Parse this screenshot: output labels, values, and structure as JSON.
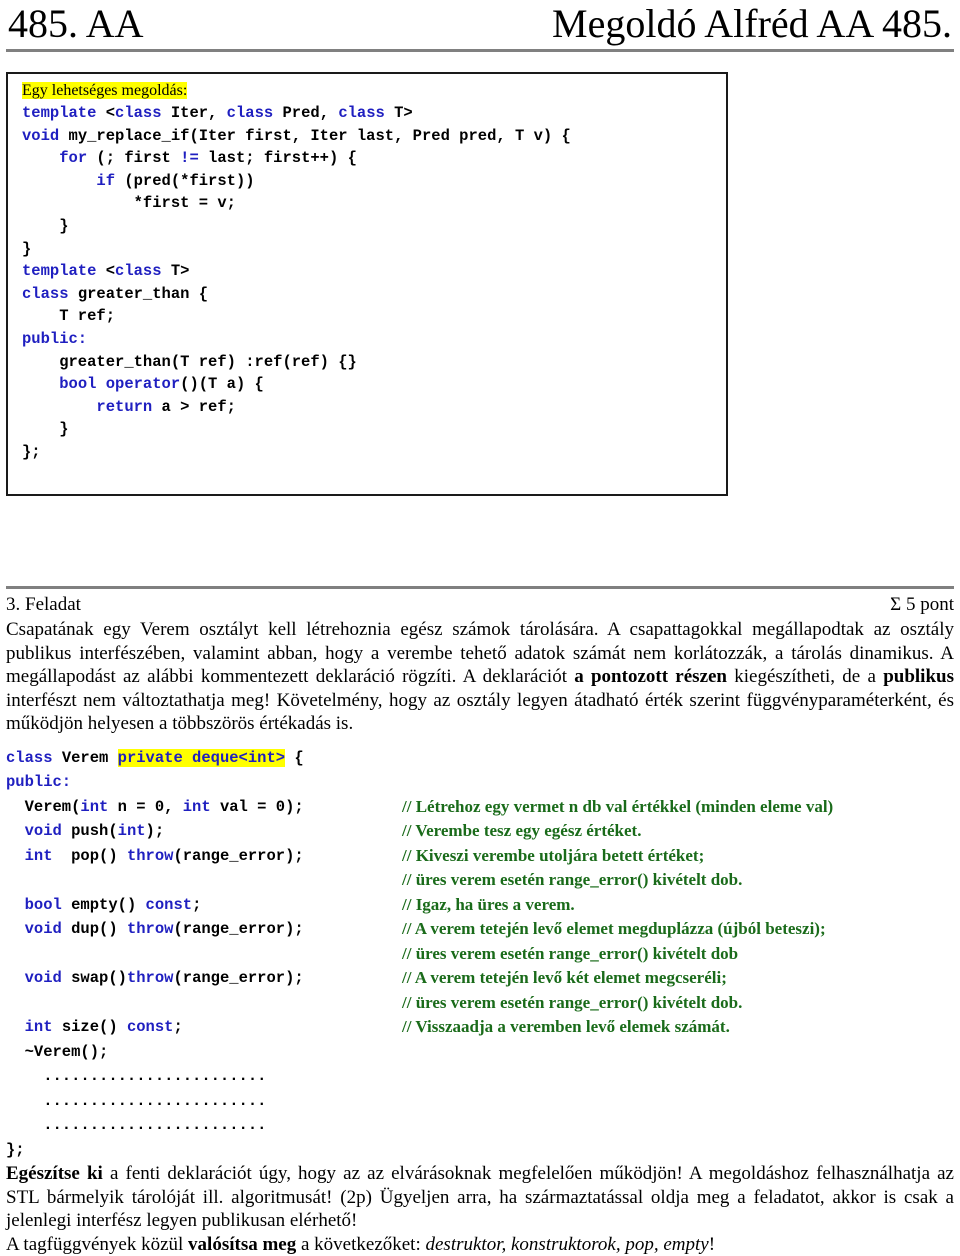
{
  "header": {
    "left": "485. AA",
    "right": "Megoldó Alfréd AA 485."
  },
  "solution_box": {
    "lead_label": "Egy lehetséges megoldás:",
    "lines": [
      [
        {
          "t": "template ",
          "c": "kw"
        },
        {
          "t": "<",
          "c": "plain"
        },
        {
          "t": "class",
          "c": "kw"
        },
        {
          "t": " Iter, ",
          "c": "plain"
        },
        {
          "t": "class",
          "c": "kw"
        },
        {
          "t": " Pred, ",
          "c": "plain"
        },
        {
          "t": "class",
          "c": "kw"
        },
        {
          "t": " T>",
          "c": "plain"
        }
      ],
      [
        {
          "t": "void",
          "c": "kw"
        },
        {
          "t": " my_replace_if(Iter first, Iter last, Pred pred, T v) {",
          "c": "plain"
        }
      ],
      [
        {
          "t": "    ",
          "c": "plain"
        },
        {
          "t": "for",
          "c": "kw"
        },
        {
          "t": " (; first ",
          "c": "plain"
        },
        {
          "t": "!=",
          "c": "kw"
        },
        {
          "t": " last; first++) {",
          "c": "plain"
        }
      ],
      [
        {
          "t": "        ",
          "c": "plain"
        },
        {
          "t": "if",
          "c": "kw"
        },
        {
          "t": " (pred(*first))",
          "c": "plain"
        }
      ],
      [
        {
          "t": "            *first = v;",
          "c": "plain"
        }
      ],
      [
        {
          "t": "    }",
          "c": "plain"
        }
      ],
      [
        {
          "t": "}",
          "c": "plain"
        }
      ],
      [
        {
          "t": "template ",
          "c": "kw"
        },
        {
          "t": "<",
          "c": "plain"
        },
        {
          "t": "class",
          "c": "kw"
        },
        {
          "t": " T>",
          "c": "plain"
        }
      ],
      [
        {
          "t": "class",
          "c": "kw"
        },
        {
          "t": " greater_than {",
          "c": "plain"
        }
      ],
      [
        {
          "t": "    T ref;",
          "c": "plain"
        }
      ],
      [
        {
          "t": "public:",
          "c": "kw"
        }
      ],
      [
        {
          "t": "    greater_than(T ref) :ref(ref) {}",
          "c": "plain"
        }
      ],
      [
        {
          "t": "    ",
          "c": "plain"
        },
        {
          "t": "bool operator",
          "c": "kw"
        },
        {
          "t": "()(T a) {",
          "c": "plain"
        }
      ],
      [
        {
          "t": "        ",
          "c": "plain"
        },
        {
          "t": "return",
          "c": "kw"
        },
        {
          "t": " a > ref;",
          "c": "plain"
        }
      ],
      [
        {
          "t": "    }",
          "c": "plain"
        }
      ],
      [
        {
          "t": "};",
          "c": "plain"
        }
      ]
    ]
  },
  "task": {
    "number_label": "3. Feladat",
    "points_label": "Σ 5 pont",
    "paragraph_parts": [
      {
        "t": "Csapatának egy Verem osztályt kell létrehoznia egész számok tárolására. A csapattagokkal megállapodtak az osztály publikus interfészében, valamint abban, hogy a verembe tehető adatok számát nem korlátozzák, a tárolás dinamikus. A megállapodást az alábbi kommentezett deklaráció rögzíti. A deklarációt ",
        "s": "normal"
      },
      {
        "t": "a pontozott részen",
        "s": "bold"
      },
      {
        "t": " kiegészítheti, de a ",
        "s": "normal"
      },
      {
        "t": "publikus",
        "s": "bold"
      },
      {
        "t": " interfészt nem változtathatja meg! Követelmény, hogy az osztály legyen átadható érték szerint függvényparaméterként, és működjön helyesen a többszörös értékadás is.",
        "s": "normal"
      }
    ]
  },
  "declaration": {
    "rows": [
      {
        "code": [
          {
            "t": "class",
            "c": "kw"
          },
          {
            "t": " Verem ",
            "c": "plain"
          },
          {
            "t": "private deque<int>",
            "c": "kw-hl"
          },
          {
            "t": " {",
            "c": "plain"
          }
        ],
        "comment": ""
      },
      {
        "code": [
          {
            "t": "public:",
            "c": "kw"
          }
        ],
        "comment": ""
      },
      {
        "code": [
          {
            "t": "  Verem(",
            "c": "plain"
          },
          {
            "t": "int",
            "c": "kw"
          },
          {
            "t": " n = 0, ",
            "c": "plain"
          },
          {
            "t": "int",
            "c": "kw"
          },
          {
            "t": " val = 0);",
            "c": "plain"
          }
        ],
        "comment": "// Létrehoz egy vermet n db val értékkel (minden eleme val)"
      },
      {
        "code": [
          {
            "t": "  ",
            "c": "plain"
          },
          {
            "t": "void",
            "c": "kw"
          },
          {
            "t": " push(",
            "c": "plain"
          },
          {
            "t": "int",
            "c": "kw"
          },
          {
            "t": ");",
            "c": "plain"
          }
        ],
        "comment": "// Verembe tesz egy egész értéket."
      },
      {
        "code": [
          {
            "t": "  ",
            "c": "plain"
          },
          {
            "t": "int",
            "c": "kw"
          },
          {
            "t": "  pop() ",
            "c": "plain"
          },
          {
            "t": "throw",
            "c": "kw"
          },
          {
            "t": "(range_error);",
            "c": "plain"
          }
        ],
        "comment": "// Kiveszi verembe utoljára betett értéket;"
      },
      {
        "code": [
          {
            "t": "",
            "c": "plain"
          }
        ],
        "comment": "// üres verem esetén range_error() kivételt dob."
      },
      {
        "code": [
          {
            "t": "  ",
            "c": "plain"
          },
          {
            "t": "bool",
            "c": "kw"
          },
          {
            "t": " empty() ",
            "c": "plain"
          },
          {
            "t": "const",
            "c": "kw"
          },
          {
            "t": ";",
            "c": "plain"
          }
        ],
        "comment": "// Igaz, ha üres a verem."
      },
      {
        "code": [
          {
            "t": "  ",
            "c": "plain"
          },
          {
            "t": "void",
            "c": "kw"
          },
          {
            "t": " dup() ",
            "c": "plain"
          },
          {
            "t": "throw",
            "c": "kw"
          },
          {
            "t": "(range_error);",
            "c": "plain"
          }
        ],
        "comment": "// A verem tetején levő elemet megduplázza (újból beteszi);"
      },
      {
        "code": [
          {
            "t": "",
            "c": "plain"
          }
        ],
        "comment": "// üres verem esetén range_error() kivételt dob"
      },
      {
        "code": [
          {
            "t": "  ",
            "c": "plain"
          },
          {
            "t": "void",
            "c": "kw"
          },
          {
            "t": " swap()",
            "c": "plain"
          },
          {
            "t": "throw",
            "c": "kw"
          },
          {
            "t": "(range_error);",
            "c": "plain"
          }
        ],
        "comment": "// A verem tetején levő két elemet megcseréli;"
      },
      {
        "code": [
          {
            "t": "",
            "c": "plain"
          }
        ],
        "comment": "// üres verem esetén range_error() kivételt dob."
      },
      {
        "code": [
          {
            "t": "  ",
            "c": "plain"
          },
          {
            "t": "int",
            "c": "kw"
          },
          {
            "t": " size() ",
            "c": "plain"
          },
          {
            "t": "const",
            "c": "kw"
          },
          {
            "t": ";",
            "c": "plain"
          }
        ],
        "comment": "// Visszaadja a veremben levő elemek számát."
      },
      {
        "code": [
          {
            "t": "  ~Verem();",
            "c": "plain"
          }
        ],
        "comment": ""
      },
      {
        "code": [
          {
            "t": "    ........................",
            "c": "plain"
          }
        ],
        "comment": ""
      },
      {
        "code": [
          {
            "t": "    ........................",
            "c": "plain"
          }
        ],
        "comment": ""
      },
      {
        "code": [
          {
            "t": "    ........................",
            "c": "plain"
          }
        ],
        "comment": ""
      },
      {
        "code": [
          {
            "t": "};",
            "c": "plain"
          }
        ],
        "comment": ""
      }
    ]
  },
  "footer": {
    "paragraph_parts": [
      {
        "t": "Egészítse ki",
        "s": "bold"
      },
      {
        "t": " a fenti deklarációt úgy, hogy az az elvárásoknak megfelelően működjön! A megoldáshoz felhasználhatja az STL bármelyik tárolóját ill. algoritmusát! (2p) Ügyeljen arra, ha származtatással oldja meg a feladatot, akkor is csak a jelenlegi interfész legyen publikusan elérhető!",
        "s": "normal"
      }
    ],
    "last_line_parts": [
      {
        "t": "A tagfüggvények közül ",
        "s": "normal"
      },
      {
        "t": "valósítsa meg",
        "s": "bold"
      },
      {
        "t": " a következőket: ",
        "s": "normal"
      },
      {
        "t": "destruktor, konstruktorok, pop, empty",
        "s": "italic"
      },
      {
        "t": "!",
        "s": "normal"
      }
    ]
  },
  "colors": {
    "keyword_blue": "#1f1fc0",
    "comment_green": "#1a6b1a",
    "highlight_yellow": "#ffff00",
    "rule_gray": "#808080"
  }
}
